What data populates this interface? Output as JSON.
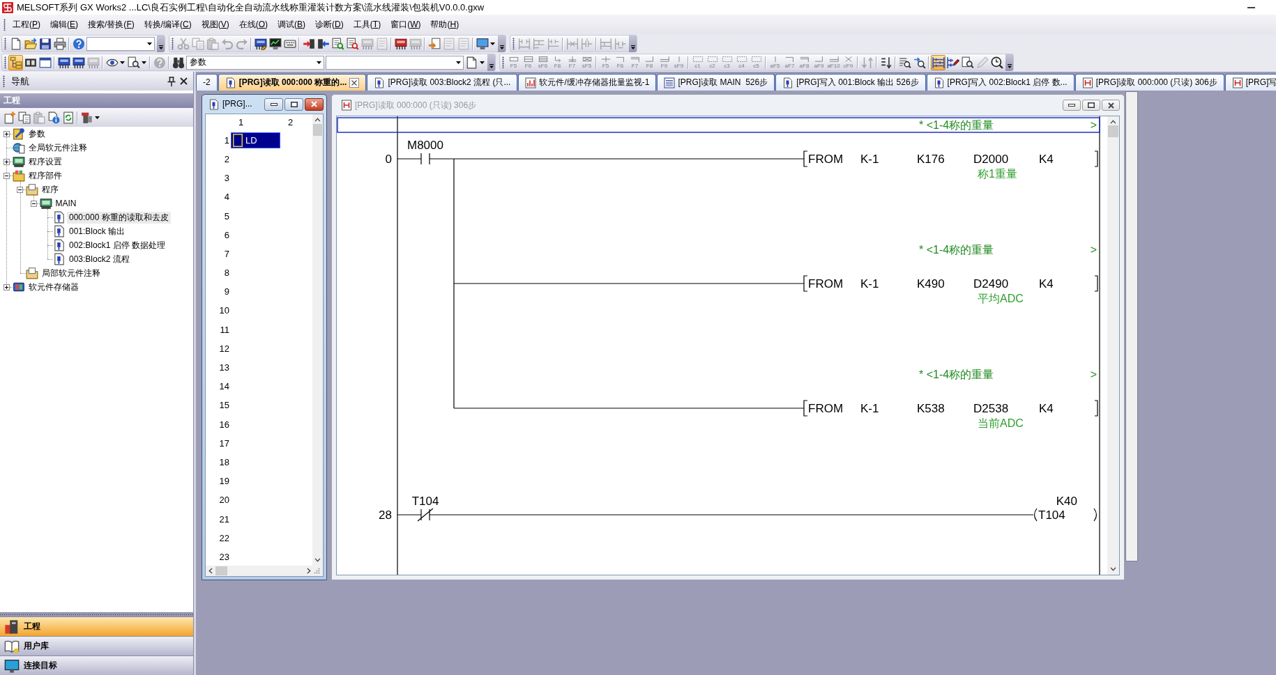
{
  "title_bar": {
    "title": "MELSOFT系列 GX Works2 ...LC\\良石实例工程\\自动化全自动流水线称重灌装计数方案\\流水线灌装\\包装机V0.0.0.gxw"
  },
  "menu": [
    "工程(P)",
    "编辑(E)",
    "搜索/替换(F)",
    "转换/编译(C)",
    "视图(V)",
    "在线(O)",
    "调试(B)",
    "诊断(D)",
    "工具(T)",
    "窗口(W)",
    "帮助(H)"
  ],
  "toolbar_rows": [
    [
      {
        "clusters": [
          [
            {
              "kind": "button",
              "disabled": false,
              "pressed": false
            },
            {
              "kind": "button",
              "disabled": false,
              "pressed": false
            },
            {
              "kind": "button",
              "disabled": false,
              "pressed": false
            },
            {
              "kind": "button",
              "disabled": false,
              "pressed": false
            }
          ],
          [
            {
              "kind": "button",
              "disabled": false,
              "pressed": false
            },
            {
              "kind": "dropdown"
            }
          ]
        ]
      },
      {
        "clusters": [
          [
            {
              "kind": "button",
              "disabled": true,
              "pressed": false
            },
            {
              "kind": "button",
              "disabled": true,
              "pressed": false
            },
            {
              "kind": "button",
              "disabled": true,
              "pressed": false
            },
            {
              "kind": "button",
              "disabled": true,
              "pressed": false
            },
            {
              "kind": "button",
              "disabled": true,
              "pressed": false
            }
          ],
          [
            {
              "kind": "button",
              "disabled": false,
              "pressed": false
            },
            {
              "kind": "button",
              "disabled": false,
              "pressed": false
            },
            {
              "kind": "button",
              "disabled": false,
              "pressed": false
            }
          ],
          [
            {
              "kind": "button",
              "disabled": false,
              "pressed": false
            },
            {
              "kind": "button",
              "disabled": false,
              "pressed": false
            },
            {
              "kind": "button",
              "disabled": false,
              "pressed": false
            },
            {
              "kind": "button",
              "disabled": false,
              "pressed": false
            },
            {
              "kind": "button",
              "disabled": true,
              "pressed": false
            },
            {
              "kind": "button",
              "disabled": true,
              "pressed": false
            }
          ],
          [
            {
              "kind": "button",
              "disabled": false,
              "pressed": false
            },
            {
              "kind": "button",
              "disabled": true,
              "pressed": false
            }
          ],
          [
            {
              "kind": "button",
              "disabled": false,
              "pressed": false
            },
            {
              "kind": "button",
              "disabled": true,
              "pressed": false
            },
            {
              "kind": "button",
              "disabled": true,
              "pressed": false
            }
          ],
          [
            {
              "kind": "menu-button",
              "disabled": false,
              "pressed": false
            }
          ]
        ]
      },
      {
        "clusters": [
          [
            {
              "kind": "button",
              "disabled": true,
              "pressed": false
            },
            {
              "kind": "button",
              "disabled": true,
              "pressed": false
            },
            {
              "kind": "button",
              "disabled": true,
              "pressed": false
            }
          ],
          [
            {
              "kind": "button",
              "disabled": true,
              "pressed": false
            },
            {
              "kind": "button",
              "disabled": true,
              "pressed": false
            }
          ],
          [
            {
              "kind": "button",
              "disabled": true,
              "pressed": false
            },
            {
              "kind": "button",
              "disabled": true,
              "pressed": false
            }
          ]
        ]
      }
    ],
    [
      {
        "clusters": [
          [
            {
              "kind": "button",
              "disabled": false,
              "pressed": true
            },
            {
              "kind": "button",
              "disabled": false,
              "pressed": false
            },
            {
              "kind": "button",
              "disabled": false,
              "pressed": false
            }
          ],
          [
            {
              "kind": "button",
              "disabled": false,
              "pressed": false
            },
            {
              "kind": "button",
              "disabled": false,
              "pressed": false
            },
            {
              "kind": "button",
              "disabled": true,
              "pressed": false
            }
          ],
          [
            {
              "kind": "menu-button",
              "disabled": false,
              "pressed": false
            },
            {
              "kind": "menu-button",
              "disabled": false,
              "pressed": false
            }
          ],
          [
            {
              "kind": "button",
              "disabled": true,
              "pressed": false
            }
          ],
          [
            {
              "kind": "button",
              "disabled": false,
              "pressed": false
            },
            {
              "kind": "dropdown",
              "value": "参数"
            },
            {
              "kind": "dropdown"
            },
            {
              "kind": "menu-button",
              "disabled": false,
              "pressed": false
            }
          ]
        ]
      },
      {
        "clusters": [
          [
            {
              "kind": "fkey",
              "label": "F5",
              "disabled": true,
              "pressed": false
            },
            {
              "kind": "fkey",
              "label": "F6",
              "disabled": true,
              "pressed": false
            },
            {
              "kind": "fkey",
              "label": "sF6",
              "disabled": true,
              "pressed": false
            },
            {
              "kind": "fkey",
              "label": "F8",
              "disabled": true,
              "pressed": false
            },
            {
              "kind": "fkey",
              "label": "F7",
              "disabled": true,
              "pressed": false
            },
            {
              "kind": "fkey",
              "label": "sF5",
              "disabled": true,
              "pressed": false
            }
          ],
          [
            {
              "kind": "fkey",
              "label": "F5",
              "disabled": true,
              "pressed": false
            },
            {
              "kind": "fkey",
              "label": "F6",
              "disabled": true,
              "pressed": false
            },
            {
              "kind": "fkey",
              "label": "F7",
              "disabled": true,
              "pressed": false
            },
            {
              "kind": "fkey",
              "label": "F8",
              "disabled": true,
              "pressed": false
            },
            {
              "kind": "fkey",
              "label": "F9",
              "disabled": true,
              "pressed": false
            },
            {
              "kind": "fkey",
              "label": "sF9",
              "disabled": true,
              "pressed": false
            }
          ],
          [
            {
              "kind": "fkey",
              "label": "c1",
              "disabled": true,
              "pressed": false
            },
            {
              "kind": "fkey",
              "label": "c2",
              "disabled": true,
              "pressed": false
            },
            {
              "kind": "fkey",
              "label": "c3",
              "disabled": true,
              "pressed": false
            },
            {
              "kind": "fkey",
              "label": "c4",
              "disabled": true,
              "pressed": false
            },
            {
              "kind": "fkey",
              "label": "c5",
              "disabled": true,
              "pressed": false
            }
          ],
          [
            {
              "kind": "fkey",
              "label": "aF5",
              "disabled": true,
              "pressed": false
            },
            {
              "kind": "fkey",
              "label": "aF7",
              "disabled": true,
              "pressed": false
            },
            {
              "kind": "fkey",
              "label": "aF8",
              "disabled": true,
              "pressed": false
            },
            {
              "kind": "fkey",
              "label": "aF9",
              "disabled": true,
              "pressed": false
            },
            {
              "kind": "fkey",
              "label": "aF10",
              "disabled": true,
              "pressed": false
            },
            {
              "kind": "fkey",
              "label": "cF9",
              "disabled": true,
              "pressed": false
            }
          ],
          [
            {
              "kind": "button",
              "disabled": true,
              "pressed": false
            }
          ],
          [
            {
              "kind": "button",
              "disabled": false,
              "pressed": false
            }
          ],
          [
            {
              "kind": "button",
              "disabled": false,
              "pressed": false
            },
            {
              "kind": "button",
              "disabled": false,
              "pressed": false
            }
          ],
          [
            {
              "kind": "button",
              "disabled": false,
              "pressed": true
            },
            {
              "kind": "button",
              "disabled": false,
              "pressed": false
            },
            {
              "kind": "button",
              "disabled": false,
              "pressed": false
            },
            {
              "kind": "button",
              "disabled": true,
              "pressed": false
            },
            {
              "kind": "button",
              "disabled": false,
              "pressed": false
            }
          ]
        ]
      }
    ]
  ],
  "navigator": {
    "title": "导航",
    "section": "工程",
    "toolbar": [
      [
        {
          "kind": "button",
          "disabled": false
        },
        {
          "kind": "button",
          "disabled": false
        },
        {
          "kind": "button",
          "disabled": true
        },
        {
          "kind": "button",
          "disabled": false
        },
        {
          "kind": "button",
          "disabled": false
        }
      ],
      [
        {
          "kind": "menu-button",
          "disabled": false
        }
      ]
    ],
    "tree": [
      {
        "label": "参数",
        "kind": "parameter",
        "expanded": false,
        "selected": false
      },
      {
        "label": "全局软元件注释",
        "kind": "comment",
        "selected": false
      },
      {
        "label": "程序设置",
        "kind": "setting",
        "expanded": false,
        "selected": false
      },
      {
        "label": "程序部件",
        "kind": "parts",
        "expanded": true,
        "selected": false,
        "children": [
          {
            "label": "程序",
            "kind": "folder",
            "expanded": true,
            "selected": false,
            "children": [
              {
                "label": "MAIN",
                "kind": "task",
                "expanded": true,
                "selected": false,
                "children": [
                  {
                    "label": "000:000 称重的读取和去皮",
                    "kind": "program",
                    "selected": true
                  },
                  {
                    "label": "001:Block 输出",
                    "kind": "program",
                    "selected": false
                  },
                  {
                    "label": "002:Block1 启停 数据处理",
                    "kind": "program",
                    "selected": false
                  },
                  {
                    "label": "003:Block2 流程",
                    "kind": "program",
                    "selected": false
                  }
                ]
              }
            ]
          },
          {
            "label": "局部软元件注释",
            "kind": "folder",
            "selected": false
          }
        ]
      },
      {
        "label": "软元件存储器",
        "kind": "memory",
        "expanded": false,
        "selected": false
      }
    ],
    "buttons": [
      {
        "label": "工程",
        "selected": true
      },
      {
        "label": "用户库",
        "selected": false
      },
      {
        "label": "连接目标",
        "selected": false
      }
    ]
  },
  "tabs": [
    {
      "label": "-2",
      "selected": false
    },
    {
      "label": "[PRG]读取 000:000 称重的...",
      "kind": "program",
      "selected": true
    },
    {
      "label": "[PRG]读取 003:Block2 流程 (只...",
      "kind": "program",
      "selected": false
    },
    {
      "label": "软元件/缓冲存储器批量监视-1",
      "kind": "monitor",
      "selected": false
    },
    {
      "label": "[PRG]读取 MAIN  526步",
      "kind": "list",
      "selected": false
    },
    {
      "label": "[PRG]写入 001:Block 输出 526步",
      "kind": "program",
      "selected": false
    },
    {
      "label": "[PRG]写入 002:Block1 启停 数...",
      "kind": "program",
      "selected": false
    },
    {
      "label": "[PRG]读取 000:000 (只读) 306步",
      "kind": "ladder",
      "selected": false
    },
    {
      "label": "[PRG]写",
      "kind": "ladder",
      "selected": false
    }
  ],
  "windows": [
    {
      "kind": "list",
      "title": "[PRG]...",
      "active": true,
      "columns": [
        "1",
        "2"
      ],
      "rows": [
        {
          "number": "1",
          "cells": [
            "LD"
          ],
          "selected": true
        },
        {
          "number": "2",
          "selected": false
        },
        {
          "number": "3",
          "selected": false
        },
        {
          "number": "4",
          "selected": false
        },
        {
          "number": "5",
          "selected": false
        },
        {
          "number": "6",
          "selected": false
        },
        {
          "number": "7",
          "selected": false
        },
        {
          "number": "8",
          "selected": false
        },
        {
          "number": "9",
          "selected": false
        },
        {
          "number": "10",
          "selected": false
        },
        {
          "number": "11",
          "selected": false
        },
        {
          "number": "12",
          "selected": false
        },
        {
          "number": "13",
          "selected": false
        },
        {
          "number": "14",
          "selected": false
        },
        {
          "number": "15",
          "selected": false
        },
        {
          "number": "16",
          "selected": false
        },
        {
          "number": "17",
          "selected": false
        },
        {
          "number": "18",
          "selected": false
        },
        {
          "number": "19",
          "selected": false
        },
        {
          "number": "20",
          "selected": false
        },
        {
          "number": "21",
          "selected": false
        },
        {
          "number": "22",
          "selected": false
        },
        {
          "number": "23",
          "selected": false
        }
      ]
    },
    {
      "kind": "ladder",
      "title": "[PRG]读取 000:000 (只读) 306步",
      "active": false,
      "ladder": {
        "rungs": [
          {
            "step": "0",
            "contact": {
              "kind": "no",
              "device": "M8000"
            },
            "outputs": [
              {
                "selected": true,
                "statement": "* <1-4称的重量",
                "statement_end": ">",
                "kind": "instruction",
                "operands": [
                  "FROM",
                  "K-1",
                  "K176",
                  "D2000",
                  "K4"
                ],
                "comment": "称1重量"
              },
              {
                "selected": false,
                "statement": "* <1-4称的重量",
                "statement_end": ">",
                "kind": "instruction",
                "operands": [
                  "FROM",
                  "K-1",
                  "K490",
                  "D2490",
                  "K4"
                ],
                "comment": "平均ADC"
              },
              {
                "selected": false,
                "statement": "* <1-4称的重量",
                "statement_end": ">",
                "kind": "instruction",
                "operands": [
                  "FROM",
                  "K-1",
                  "K538",
                  "D2538",
                  "K4"
                ],
                "comment": "当前ADC"
              }
            ]
          },
          {
            "step": "28",
            "contact": {
              "kind": "nc",
              "device": "T104"
            },
            "outputs": [
              {
                "selected": false,
                "kind": "coil",
                "device": "T104",
                "setting": "K40"
              }
            ]
          }
        ]
      }
    }
  ]
}
